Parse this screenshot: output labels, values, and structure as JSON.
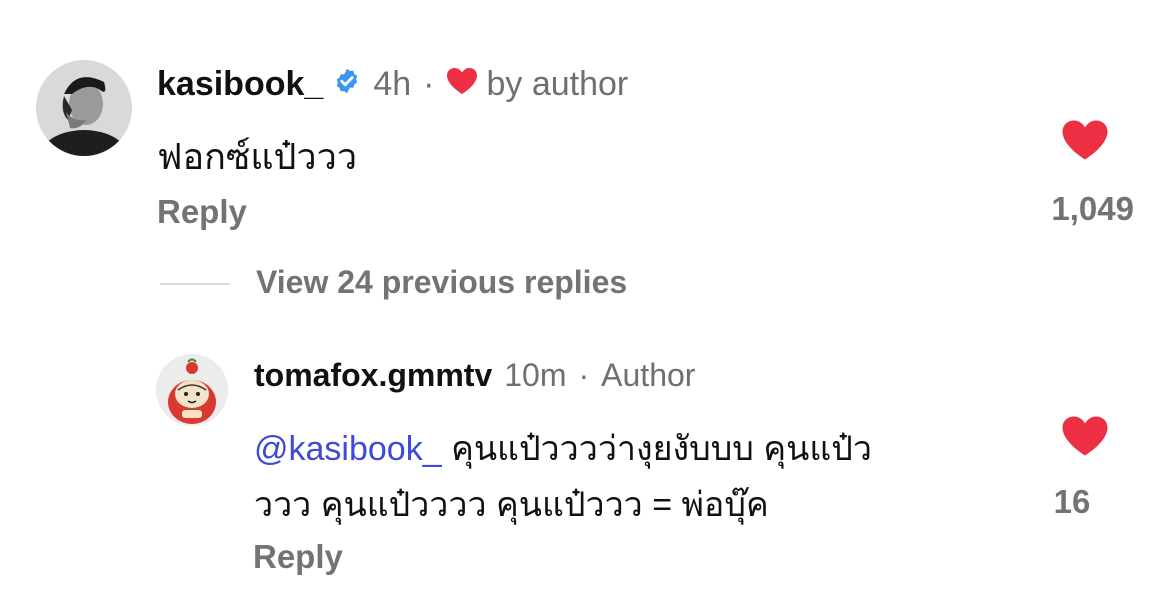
{
  "comment": {
    "username": "kasibook_",
    "time": "4h",
    "separator": "·",
    "liked_by_author_label": "by author",
    "text": "ฟอกซ์แป๋ววว",
    "reply_label": "Reply",
    "like_count": "1,049"
  },
  "view_replies_label": "View 24 previous replies",
  "reply": {
    "username": "tomafox.gmmtv",
    "time": "10m",
    "separator": "·",
    "badge": "Author",
    "mention": "@kasibook_",
    "text_line1": " คุนแป๋วววว่างุยงับบบ คุนแป๋ว",
    "text_line2": "ววว คุนแป๋วววว คุนแป๋ววว = พ่อบุ๊ค",
    "reply_label": "Reply",
    "like_count": "16"
  },
  "colors": {
    "like_red": "#ed2f44",
    "verified_blue": "#3897f0",
    "mention_blue": "#3d4bd6",
    "muted_gray": "#737373"
  }
}
